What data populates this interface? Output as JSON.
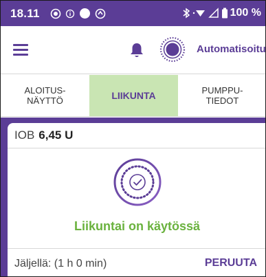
{
  "status_bar": {
    "time": "18.11",
    "battery_percent": "100 %",
    "icons": [
      "record-icon",
      "info-icon",
      "filled-circle-icon",
      "sync-icon",
      "bluetooth-icon",
      "wifi-icon",
      "signal-icon",
      "battery-icon"
    ]
  },
  "header": {
    "menu_icon": "hamburger-menu-icon",
    "notification_icon": "bell-icon",
    "pod_icon": "pod-icon",
    "mode_label": "Automatisoitu"
  },
  "tabs": [
    {
      "label": "ALOITUS-\nNÄYTTÖ",
      "active": false
    },
    {
      "label": "LIIKUNTA",
      "active": true
    },
    {
      "label": "PUMPPU-\nTIEDOT",
      "active": false
    }
  ],
  "main": {
    "iob_label": "IOB",
    "iob_value": "6,45 U",
    "status_text": "Liikuntai on käytössä",
    "remaining_text": "Jäljellä: (1 h 0 min)",
    "cancel_label": "PERUUTA"
  },
  "colors": {
    "brand_purple": "#5b3d96",
    "active_tab_bg": "#c9e5b3",
    "status_green": "#6ab23e"
  }
}
